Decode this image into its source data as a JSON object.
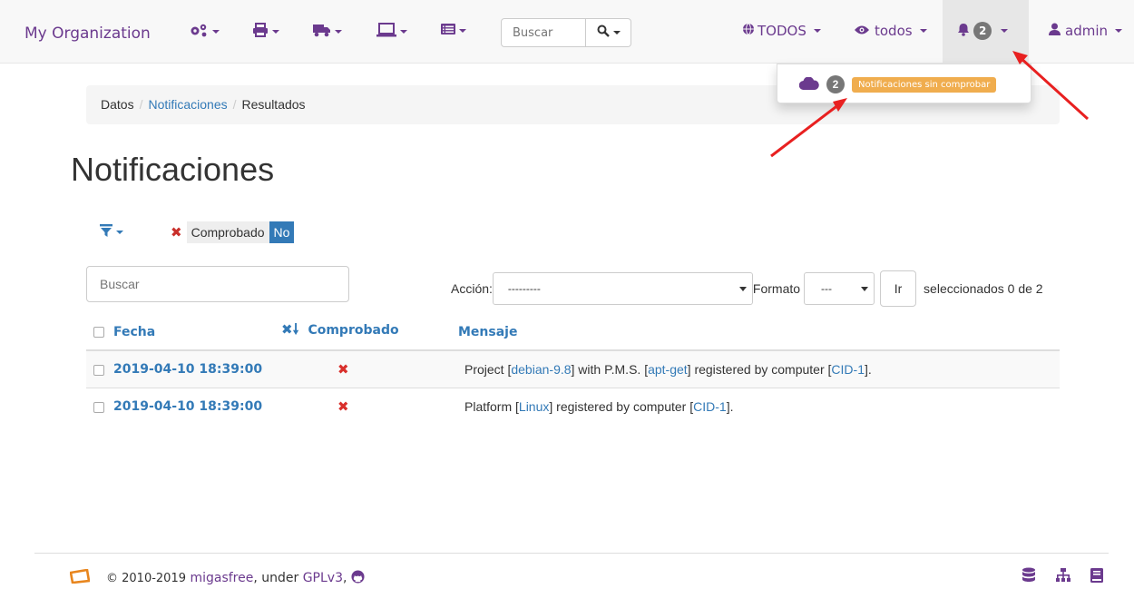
{
  "navbar": {
    "brand": "My Organization",
    "search_placeholder": "Buscar",
    "scope_label": "TODOS",
    "view_label": "todos",
    "notif_count": "2",
    "user_label": "admin"
  },
  "dropdown": {
    "count": "2",
    "label": "Notificaciones sin comprobar"
  },
  "breadcrumb": {
    "items": [
      "Datos",
      "Notificaciones",
      "Resultados"
    ]
  },
  "page": {
    "title": "Notificaciones",
    "filter_chip_label": "Comprobado",
    "filter_chip_value": "No",
    "search_placeholder": "Buscar",
    "action_label": "Acción:",
    "action_value": "---------",
    "format_label": "Formato",
    "format_value": "---",
    "go_label": "Ir",
    "selected_text": "seleccionados 0 de 2"
  },
  "table": {
    "headers": [
      "Fecha",
      "Comprobado",
      "Mensaje"
    ],
    "rows": [
      {
        "date": "2019-04-10 18:39:00",
        "msg_parts": [
          "Project [",
          "debian-9.8",
          "] with P.M.S. [",
          "apt-get",
          "] registered by computer [",
          "CID-1",
          "]."
        ]
      },
      {
        "date": "2019-04-10 18:39:00",
        "msg_parts": [
          "Platform [",
          "Linux",
          "] registered by computer [",
          "CID-1",
          "]."
        ]
      }
    ]
  },
  "footer": {
    "copyright": "© 2010-2019",
    "project": "migasfree",
    "under": ", under",
    "license": "GPLv3",
    "comma": ","
  },
  "colors": {
    "brand": "#6b3a8e",
    "link": "#337ab7",
    "warning": "#f0ad4e",
    "danger": "#d9302c"
  },
  "icons": [
    "gears-icon",
    "print-icon",
    "truck-icon",
    "laptop-icon",
    "list-icon",
    "search-icon",
    "globe-icon",
    "eye-icon",
    "bell-icon",
    "user-icon",
    "cloud-icon",
    "filter-icon",
    "remove-icon",
    "sort-desc-icon",
    "logo-icon",
    "github-icon",
    "database-icon",
    "sitemap-icon",
    "book-icon"
  ]
}
